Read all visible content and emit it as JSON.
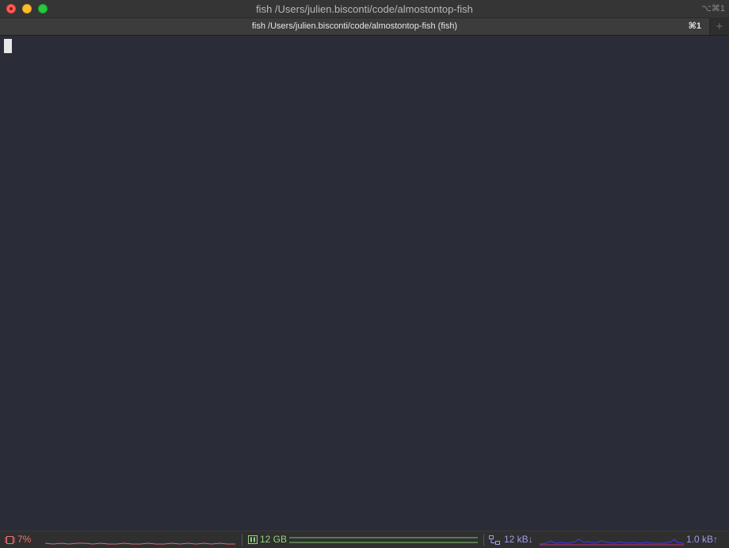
{
  "window": {
    "title": "fish /Users/julien.bisconti/code/almostontop-fish",
    "shortcut": "⌥⌘1"
  },
  "tabs": [
    {
      "label": "fish /Users/julien.bisconti/code/almostontop-fish (fish)",
      "shortcut": "⌘1"
    }
  ],
  "new_tab_label": "+",
  "status": {
    "cpu": {
      "value": "7%",
      "color": "#f27272",
      "icon": "cpu-chip-icon"
    },
    "memory": {
      "value": "12 GB",
      "color": "#8ed47a",
      "icon": "memory-icon"
    },
    "network": {
      "down": "12 kB↓",
      "up": "1.0 kB↑",
      "color": "#9a9af0",
      "icon": "network-icon"
    }
  },
  "colors": {
    "terminal_bg": "#2a2d37",
    "cpu_line": "#e06a6a",
    "mem_line": "#7ec46c",
    "net_down_line": "#3a3aff",
    "net_up_line": "#c0307a"
  }
}
